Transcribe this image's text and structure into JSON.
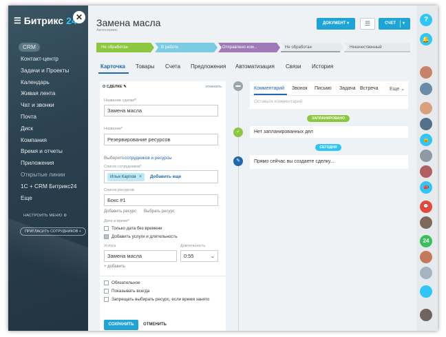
{
  "sidebar": {
    "logo_text": "Битрикс",
    "logo_num": "24",
    "items": [
      "CRM",
      "Контакт-центр",
      "Задачи и Проекты",
      "Календарь",
      "Живая лента",
      "Чат и звонки",
      "Почта",
      "Диск",
      "Компания",
      "Время и отчеты",
      "Приложения",
      "Открытые линии",
      "1С + CRM Битрикс24",
      "Еще"
    ],
    "setup_menu": "НАСТРОИТЬ МЕНЮ",
    "invite": "ПРИГЛАСИТЬ СОТРУДНИКОВ +"
  },
  "header": {
    "title": "Замена масла",
    "subtitle": "Автосервис",
    "document_btn": "ДОКУМЕНТ",
    "invoice_btn": "СЧЕТ"
  },
  "stages": [
    {
      "label": "Не обработан",
      "color": "#8dc63f"
    },
    {
      "label": "В работе",
      "color": "#7ccbe4"
    },
    {
      "label": "Отправлено ком...",
      "color": "#9f79b8"
    },
    {
      "label": "Не обработан",
      "color": "#e7eaec"
    },
    {
      "label": "Некачественный",
      "color": "#e7eaec"
    }
  ],
  "tabs": [
    "Карточка",
    "Товары",
    "Счета",
    "Предложения",
    "Автоматизация",
    "Связи",
    "История"
  ],
  "form": {
    "header": "О СДЕЛКЕ",
    "cancel": "отменить",
    "deal_name_label": "Название сделки",
    "deal_name_value": "Замена масла",
    "name_label": "Название",
    "name_value": "Резервирование ресурсов",
    "choose_prefix": "Выберите",
    "choose_link": "сотрудников и ресурсы",
    "employees_label": "Список сотрудников",
    "employee_tag": "Илья Карпов",
    "add_more": "Добавить еще",
    "resources_label": "Список ресурсов",
    "resource_value": "Бокс #1",
    "add_resource": "Добавить ресурс",
    "choose_resource": "Выбрать ресурс",
    "datetime_label": "Дата и время",
    "only_date": "Только дата без времени",
    "add_services": "Добавить услуги и длительность",
    "service_label": "Услуга",
    "duration_label": "Длительность",
    "service_value": "Замена масла",
    "duration_value": "0:55",
    "add": "+ добавить",
    "required": "Обязательное",
    "show_always": "Показывать всегда",
    "forbid_busy": "Запрещать выбирать ресурс, если время занято",
    "save": "СОХРАНИТЬ",
    "cancel_btn": "ОТМЕНИТЬ"
  },
  "timeline": {
    "tabs": [
      "Комментарий",
      "Звонок",
      "Письмо",
      "Задача",
      "Встреча",
      "Еще"
    ],
    "comment_placeholder": "Оставьте комментарий",
    "planned_pill": "ЗАПЛАНИРОВАНО",
    "no_planned": "Нет запланированных дел",
    "today_pill": "СЕГОДНЯ",
    "creating_now": "Прямо сейчас вы создаете сделку..."
  }
}
